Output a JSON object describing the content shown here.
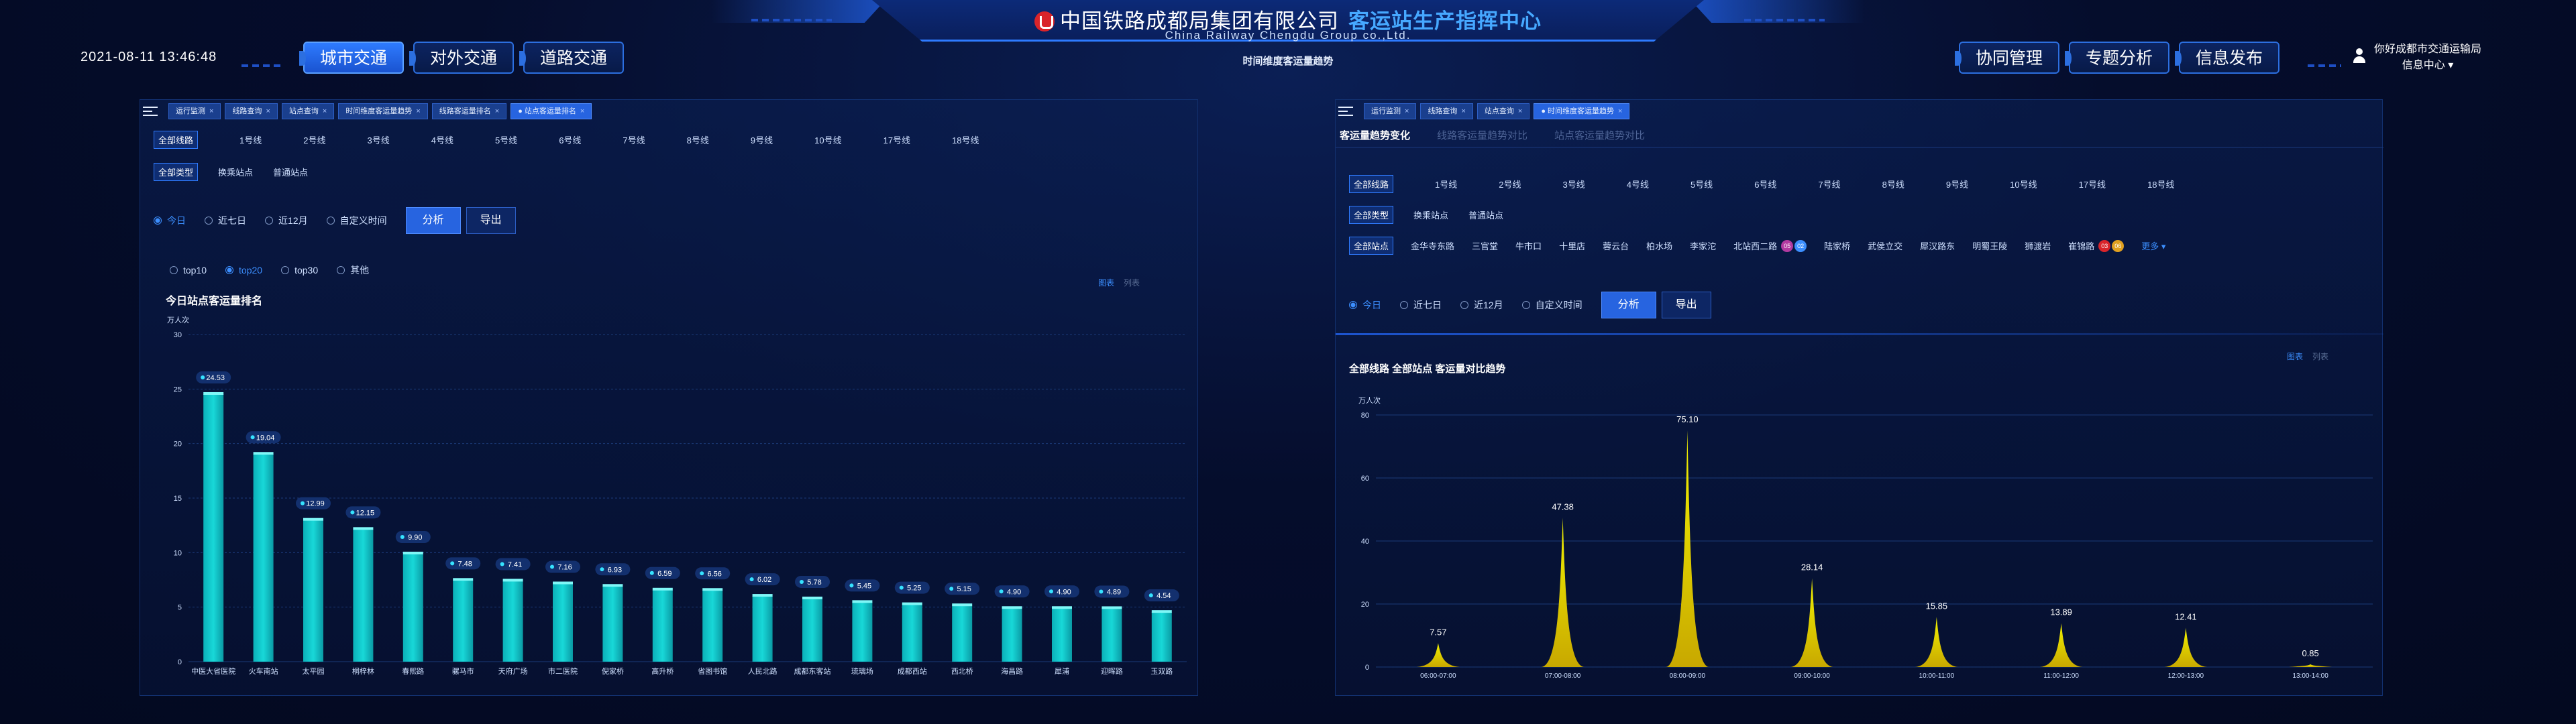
{
  "header": {
    "title_cn": "中国铁路成都局集团有限公司",
    "title_accent": "客运站生产指挥中心",
    "title_en": "China Railway Chengdu Group co.,Ltd.",
    "datetime": "2021-08-11 13:46:48",
    "center_label": "时间维度客运量趋势",
    "nav_left": [
      "城市交通",
      "对外交通",
      "道路交通"
    ],
    "nav_right": [
      "协同管理",
      "专题分析",
      "信息发布"
    ],
    "user_line1": "你好成都市交通运输局",
    "user_line2": "信息中心 ▾"
  },
  "left_panel": {
    "tabs": [
      {
        "label": "运行监测",
        "active": false
      },
      {
        "label": "线路查询",
        "active": false
      },
      {
        "label": "站点查询",
        "active": false
      },
      {
        "label": "时间维度客运量趋势",
        "active": false
      },
      {
        "label": "线路客运量排名",
        "active": false
      },
      {
        "label": "站点客运量排名",
        "active": true
      }
    ],
    "lines": [
      "全部线路",
      "1号线",
      "2号线",
      "3号线",
      "4号线",
      "5号线",
      "6号线",
      "7号线",
      "8号线",
      "9号线",
      "10号线",
      "17号线",
      "18号线"
    ],
    "types": [
      "全部类型",
      "换乘站点",
      "普通站点"
    ],
    "time_options": [
      "今日",
      "近七日",
      "近12月",
      "自定义时间"
    ],
    "analyze_label": "分析",
    "export_label": "导出",
    "top_options": [
      "top10",
      "top20",
      "top30",
      "其他"
    ],
    "view_chart": "图表",
    "view_table": "列表",
    "chart_title": "今日站点客运量排名",
    "unit": "万人次"
  },
  "right_panel": {
    "tabs": [
      {
        "label": "运行监测",
        "active": false
      },
      {
        "label": "线路查询",
        "active": false
      },
      {
        "label": "站点查询",
        "active": false
      },
      {
        "label": "时间维度客运量趋势",
        "active": true
      }
    ],
    "subtabs": [
      "客运量趋势变化",
      "线路客运量趋势对比",
      "站点客运量趋势对比"
    ],
    "lines": [
      "全部线路",
      "1号线",
      "2号线",
      "3号线",
      "4号线",
      "5号线",
      "6号线",
      "7号线",
      "8号线",
      "9号线",
      "10号线",
      "17号线",
      "18号线"
    ],
    "types": [
      "全部类型",
      "换乘站点",
      "普通站点"
    ],
    "stations": [
      "全部站点",
      "金华寺东路",
      "三官堂",
      "牛市口",
      "十里店",
      "蓉云台",
      "柏水场",
      "李家沱",
      "北站西二路",
      "陆家桥",
      "武侯立交",
      "犀汉路东",
      "明蜀王陵",
      "狮渡岩",
      "崔锦路"
    ],
    "badges_a": [
      "05",
      "02"
    ],
    "badges_b": [
      "03",
      "06"
    ],
    "more_label": "更多 ▾",
    "time_options": [
      "今日",
      "近七日",
      "近12月",
      "自定义时间"
    ],
    "analyze_label": "分析",
    "export_label": "导出",
    "view_chart": "图表",
    "view_table": "列表",
    "chart_title": "全部线路 全部站点 客运量对比趋势",
    "unit": "万人次"
  },
  "chart_data": [
    {
      "type": "bar",
      "title": "今日站点客运量排名",
      "ylabel": "万人次",
      "ylim": [
        0,
        30
      ],
      "yticks": [
        0,
        5,
        10,
        15,
        20,
        25,
        30
      ],
      "categories": [
        "中医大省医院",
        "火车南站",
        "太平园",
        "桐梓林",
        "春熙路",
        "骡马市",
        "天府广场",
        "市二医院",
        "倪家桥",
        "高升桥",
        "省图书馆",
        "人民北路",
        "成都东客站",
        "琉璃场",
        "成都西站",
        "西北桥",
        "海昌路",
        "犀浦",
        "迎晖路",
        "玉双路"
      ],
      "values": [
        24.53,
        19.04,
        12.99,
        12.15,
        9.9,
        7.48,
        7.41,
        7.16,
        6.93,
        6.59,
        6.56,
        6.02,
        5.78,
        5.45,
        5.25,
        5.15,
        4.9,
        4.9,
        4.89,
        4.54
      ],
      "labels": [
        "24.53",
        "19.04",
        "12.99",
        "12.15",
        "9.90",
        "7.48",
        "7.41",
        "7.16",
        "6.93",
        "6.59",
        "6.56",
        "6.02",
        "5.78",
        "5.45",
        "5.25",
        "5.15",
        "4.90",
        "4.90",
        "4.89",
        "4.54"
      ],
      "bar_color": "#18d8d8"
    },
    {
      "type": "area",
      "title": "全部线路 全部站点 客运量对比趋势",
      "ylabel": "万人次",
      "ylim": [
        0,
        80
      ],
      "yticks": [
        0,
        20,
        40,
        60,
        80
      ],
      "categories": [
        "06:00-07:00",
        "07:00-08:00",
        "08:00-09:00",
        "09:00-10:00",
        "10:00-11:00",
        "11:00-12:00",
        "12:00-13:00",
        "13:00-14:00"
      ],
      "values": [
        7.57,
        47.38,
        75.1,
        28.14,
        15.85,
        13.89,
        12.41,
        0.85
      ],
      "labels": [
        "7.57",
        "47.38",
        "75.10",
        "28.14",
        "15.85",
        "13.89",
        "12.41",
        "0.85"
      ],
      "fill_color": "#f2f200"
    }
  ]
}
